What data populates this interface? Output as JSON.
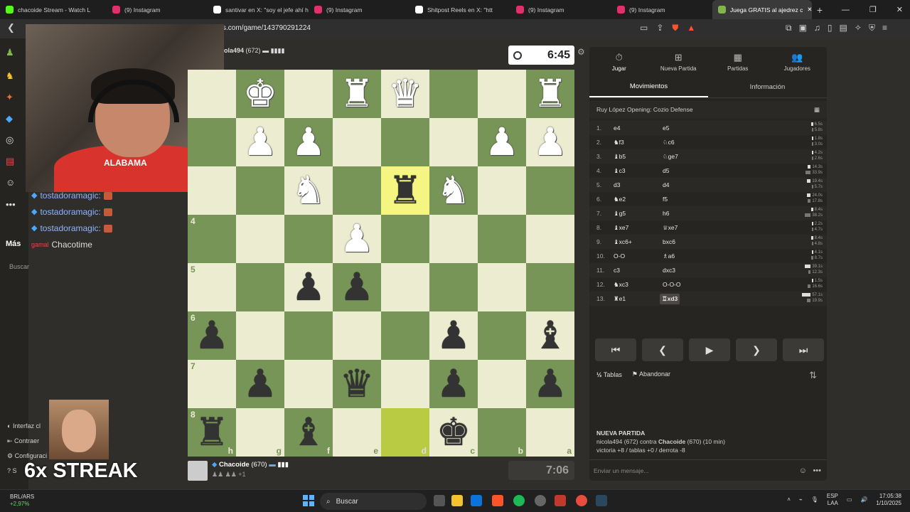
{
  "tabs": [
    {
      "label": "chacoide Stream - Watch L",
      "color": "#53fc18"
    },
    {
      "label": "(9) Instagram",
      "color": "#e1306c"
    },
    {
      "label": "santivar en X: \"soy el jefe ahí h",
      "color": "#ffffff"
    },
    {
      "label": "(9) Instagram",
      "color": "#e1306c"
    },
    {
      "label": "Shitpost Reels en X: \"htt",
      "color": "#ffffff"
    },
    {
      "label": "(9) Instagram",
      "color": "#e1306c"
    },
    {
      "label": "(9) Instagram",
      "color": "#e1306c"
    },
    {
      "label": "Juega GRATIS al ajedrez c",
      "color": "#81b64c"
    }
  ],
  "address": {
    "url": "s.com/game/143790291224"
  },
  "stream": {
    "shirt_text": "ALABAMA",
    "mas_label": "Más",
    "buscar": "Buscar",
    "chat": [
      {
        "user": "tostadoramagic:"
      },
      {
        "user": "tostadoramagic:"
      },
      {
        "user": "tostadoramagic:"
      }
    ],
    "chacotime_prefix": "gamal",
    "chacotime": "Chacotime",
    "side_items": [
      "Interfaz cl",
      "Contraer",
      "Configuraci",
      "S"
    ],
    "streak": "6x STREAK"
  },
  "opponent": {
    "name": "ola494",
    "rating": "(672)"
  },
  "clocks": {
    "top": "6:45",
    "bottom": "7:06"
  },
  "me": {
    "name": "Chacoide",
    "rating": "(670)",
    "extra": "+1"
  },
  "ranks": [
    "4",
    "5",
    "6",
    "7",
    "8"
  ],
  "files": [
    "h",
    "g",
    "f",
    "e",
    "d",
    "c",
    "b",
    "a"
  ],
  "board": [
    [
      "",
      "K",
      "",
      "R",
      "Q",
      "",
      "",
      "R"
    ],
    [
      "",
      "P",
      "P",
      "",
      "",
      "",
      "P",
      "P"
    ],
    [
      "",
      "",
      "N",
      "",
      "r",
      "N",
      "",
      ""
    ],
    [
      "",
      "",
      "",
      "P",
      "",
      "",
      "",
      ""
    ],
    [
      "",
      "",
      "p",
      "p",
      "",
      "",
      "",
      ""
    ],
    [
      "p",
      "",
      "",
      "",
      "",
      "p",
      "",
      "b"
    ],
    [
      "",
      "p",
      "",
      "q",
      "",
      "p",
      "",
      "p"
    ],
    [
      "r",
      "",
      "b",
      "",
      "",
      "k",
      "",
      ""
    ]
  ],
  "panel": {
    "tabs": [
      {
        "label": "Jugar",
        "icon": "⏱"
      },
      {
        "label": "Nueva Partida",
        "icon": "⊞"
      },
      {
        "label": "Partidas",
        "icon": "▦"
      },
      {
        "label": "Jugadores",
        "icon": "👥"
      }
    ],
    "subtabs": [
      "Movimientos",
      "Información"
    ],
    "opening": "Ruy López Opening: Cozio Defense",
    "moves": [
      {
        "n": "1.",
        "w": "e4",
        "b": "e5",
        "tw": "6.5s",
        "tb": "5.8s"
      },
      {
        "n": "2.",
        "w": "♞f3",
        "b": "♘c6",
        "tw": "1.8s",
        "tb": "3.0s"
      },
      {
        "n": "3.",
        "w": "♝b5",
        "b": "♘ge7",
        "tw": "4.2s",
        "tb": "2.6s"
      },
      {
        "n": "4.",
        "w": "♝c3",
        "b": "d5",
        "tw": "14.3s",
        "tb": "33.9s"
      },
      {
        "n": "5.",
        "w": "d3",
        "b": "d4",
        "tw": "19.4s",
        "tb": "5.7s"
      },
      {
        "n": "6.",
        "w": "♞e2",
        "b": "f5",
        "tw": "24.0s",
        "tb": "17.8s"
      },
      {
        "n": "7.",
        "w": "♝g5",
        "b": "h6",
        "tw": "8.4s",
        "tb": "38.2s"
      },
      {
        "n": "8.",
        "w": "♝xe7",
        "b": "♕xe7",
        "tw": "2.2s",
        "tb": "4.7s"
      },
      {
        "n": "9.",
        "w": "♝xc6+",
        "b": "bxc6",
        "tw": "8.4s",
        "tb": "4.8s"
      },
      {
        "n": "10.",
        "w": "O-O",
        "b": "♗a6",
        "tw": "4.1s",
        "tb": "8.7s"
      },
      {
        "n": "11.",
        "w": "c3",
        "b": "dxc3",
        "tw": "39.1s",
        "tb": "12.3s"
      },
      {
        "n": "12.",
        "w": "♞xc3",
        "b": "O-O-O",
        "tw": "1.5s",
        "tb": "16.6s"
      },
      {
        "n": "13.",
        "w": "♜e1",
        "b": "♖xd3",
        "tw": "57.1s",
        "tb": "19.9s"
      }
    ],
    "draw": "Tablas",
    "resign": "Abandonar",
    "newgame": {
      "title": "NUEVA PARTIDA",
      "line1_a": "nicola494 (672) contra ",
      "line1_b": "Chacoide",
      "line1_c": " (670) (10 min)",
      "line2": "victoria +8 / tablas +0 / derrota -8"
    },
    "chat_placeholder": "Enviar un mensaje..."
  },
  "taskbar": {
    "currency": "BRL/ARS",
    "change": "+2,97%",
    "search": "Buscar",
    "lang": "ESP",
    "lang2": "LAA",
    "time": "17:05:38",
    "date": "1/10/2025"
  }
}
